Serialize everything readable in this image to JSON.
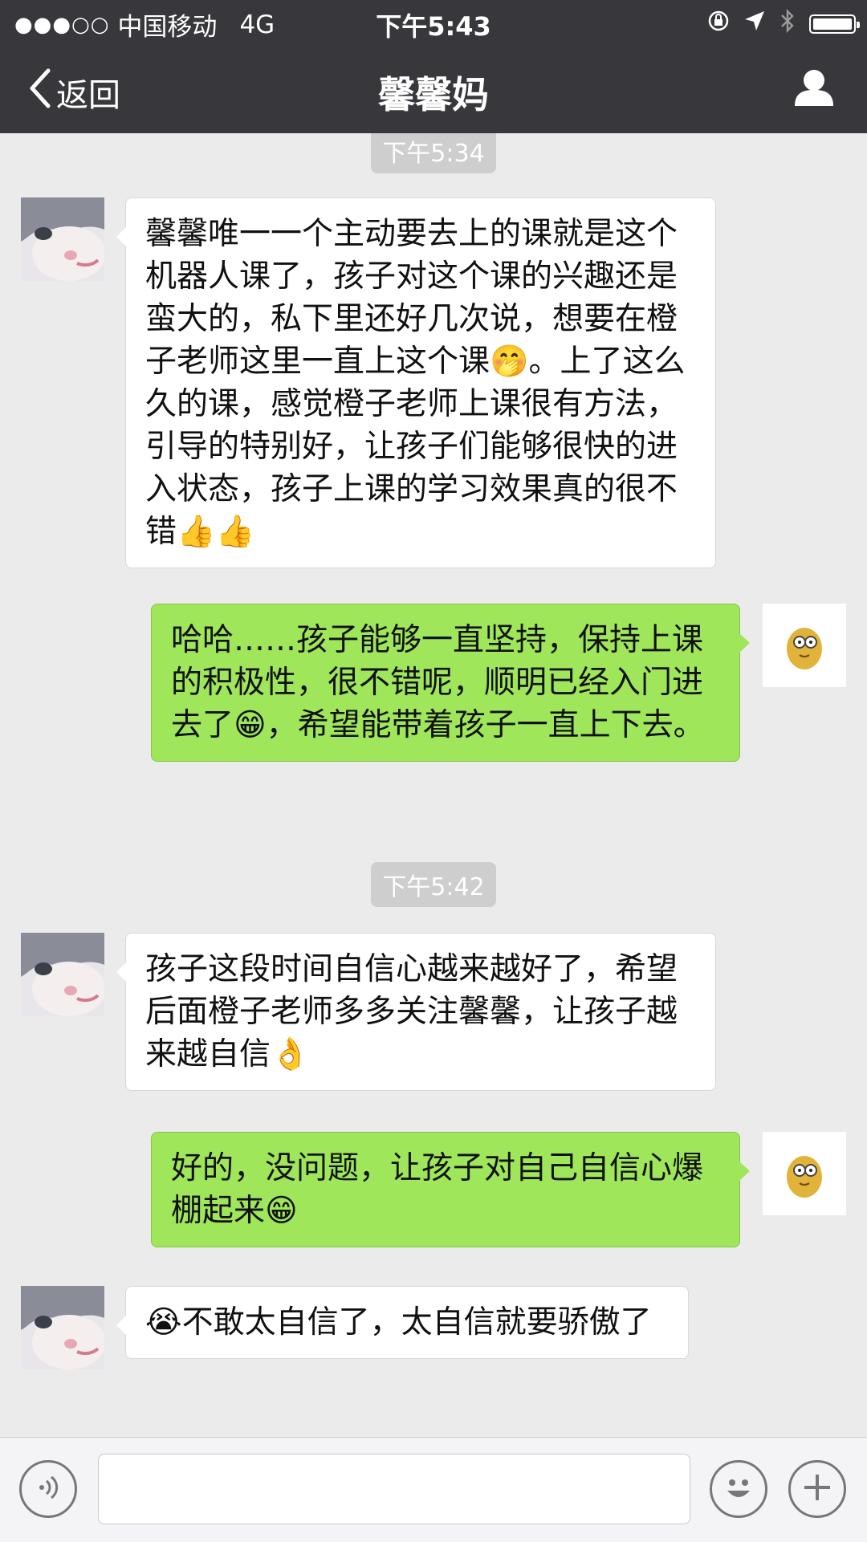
{
  "status_bar": {
    "signal_dots": "●●●○○",
    "carrier": "中国移动",
    "network": "4G",
    "time": "下午5:43"
  },
  "nav": {
    "back_label": "返回",
    "title": "馨馨妈"
  },
  "messages": [
    {
      "type": "timestamp",
      "text": "下午5:34"
    },
    {
      "type": "in",
      "text": "馨馨唯一一个主动要去上的课就是这个机器人课了，孩子对这个课的兴趣还是蛮大的，私下里还好几次说，想要在橙子老师这里一直上这个课🤭。上了这么久的课，感觉橙子老师上课很有方法，引导的特别好，让孩子们能够很快的进入状态，孩子上课的学习效果真的很不错👍👍"
    },
    {
      "type": "out",
      "text": "哈哈……孩子能够一直坚持，保持上课的积极性，很不错呢，顺明已经入门进去了😁，希望能带着孩子一直上下去。"
    },
    {
      "type": "timestamp",
      "text": "下午5:42"
    },
    {
      "type": "in",
      "text": "孩子这段时间自信心越来越好了，希望后面橙子老师多多关注馨馨，让孩子越来越自信👌"
    },
    {
      "type": "out",
      "text": "好的，没问题，让孩子对自己自信心爆棚起来😁"
    },
    {
      "type": "in",
      "text": "😭不敢太自信了，太自信就要骄傲了"
    }
  ],
  "input": {
    "placeholder": ""
  },
  "colors": {
    "nav_bg": "#37373c",
    "chat_bg": "#ebebeb",
    "outgoing_bubble": "#9fe65b",
    "incoming_bubble": "#ffffff"
  },
  "icons": [
    "back-chevron-icon",
    "profile-icon",
    "voice-icon",
    "emoji-icon",
    "plus-icon",
    "lock-rotation-icon",
    "location-icon",
    "bluetooth-icon",
    "battery-icon"
  ]
}
